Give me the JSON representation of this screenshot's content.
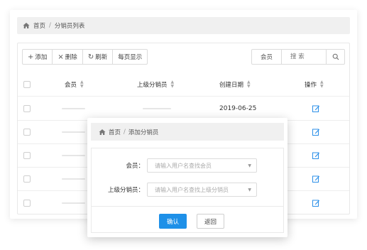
{
  "breadcrumb": {
    "home": "首页",
    "sep": "/",
    "current": "分销员列表"
  },
  "toolbar": {
    "add": "添加",
    "delete": "删除",
    "refresh": "刷新",
    "per_page": "每页显示"
  },
  "search": {
    "field": "会员",
    "placeholder": "搜 索"
  },
  "table": {
    "columns": [
      "会员",
      "上级分销员",
      "创建日期",
      "操作"
    ],
    "rows": [
      {
        "date": "2019-06-25"
      }
    ]
  },
  "modal": {
    "breadcrumb": {
      "home": "首页",
      "sep": "/",
      "current": "添加分销员"
    },
    "fields": [
      {
        "label": "会员：",
        "placeholder": "请输入用户名查找会员"
      },
      {
        "label": "上级分销员：",
        "placeholder": "请输入用户名查找上级分销员"
      }
    ],
    "confirm": "确认",
    "back": "返回"
  },
  "colors": {
    "primary": "#1e90e8",
    "edit_icon": "#2b8fe8"
  }
}
